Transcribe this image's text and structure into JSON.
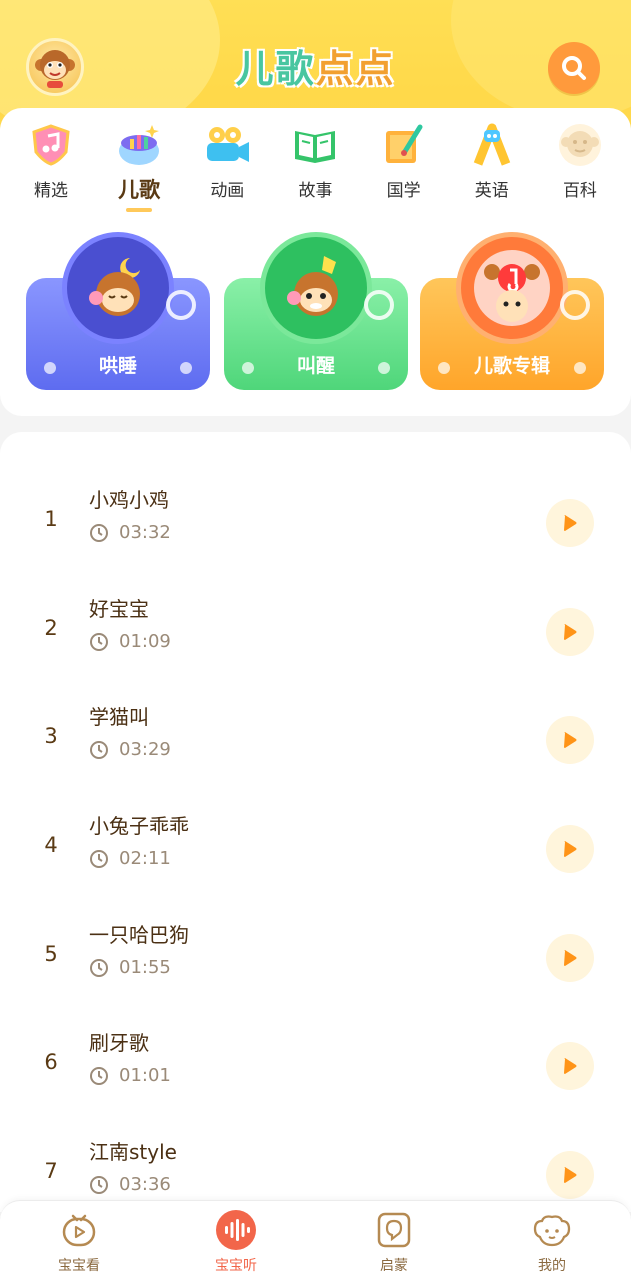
{
  "header": {
    "logo_text_part1": "儿歌",
    "logo_text_part2": "点点",
    "search_icon": "search-icon",
    "avatar_icon": "monkey-avatar-icon"
  },
  "categories": [
    {
      "label": "精选",
      "icon": "shield-music-icon",
      "active": false
    },
    {
      "label": "儿歌",
      "icon": "music-bowl-icon",
      "active": true
    },
    {
      "label": "动画",
      "icon": "video-camera-icon",
      "active": false
    },
    {
      "label": "故事",
      "icon": "open-book-icon",
      "active": false
    },
    {
      "label": "国学",
      "icon": "scroll-brush-icon",
      "active": false
    },
    {
      "label": "英语",
      "icon": "letter-robot-icon",
      "active": false
    },
    {
      "label": "百科",
      "icon": "monkey-face-icon",
      "active": false
    }
  ],
  "features": [
    {
      "label": "哄睡",
      "color": "#6a78f0"
    },
    {
      "label": "叫醒",
      "color": "#5edc86"
    },
    {
      "label": "儿歌专辑",
      "color": "#ffb23c"
    }
  ],
  "songs": [
    {
      "index": "1",
      "title": "小鸡小鸡",
      "duration": "03:32"
    },
    {
      "index": "2",
      "title": "好宝宝",
      "duration": "01:09"
    },
    {
      "index": "3",
      "title": "学猫叫",
      "duration": "03:29"
    },
    {
      "index": "4",
      "title": "小兔子乖乖",
      "duration": "02:11"
    },
    {
      "index": "5",
      "title": "一只哈巴狗",
      "duration": "01:55"
    },
    {
      "index": "6",
      "title": "刷牙歌",
      "duration": "01:01"
    },
    {
      "index": "7",
      "title": "江南style",
      "duration": "03:36"
    }
  ],
  "bottom_nav": [
    {
      "label": "宝宝看",
      "icon": "play-tv-icon",
      "active": false
    },
    {
      "label": "宝宝听",
      "icon": "sound-wave-icon",
      "active": true
    },
    {
      "label": "启蒙",
      "icon": "enlighten-icon",
      "active": false
    },
    {
      "label": "我的",
      "icon": "baby-face-icon",
      "active": false
    }
  ],
  "colors": {
    "header_yellow": "#ffdb4f",
    "accent_orange": "#ff9a3c",
    "play_orange": "#ff9418",
    "active_nav": "#f2664a"
  }
}
